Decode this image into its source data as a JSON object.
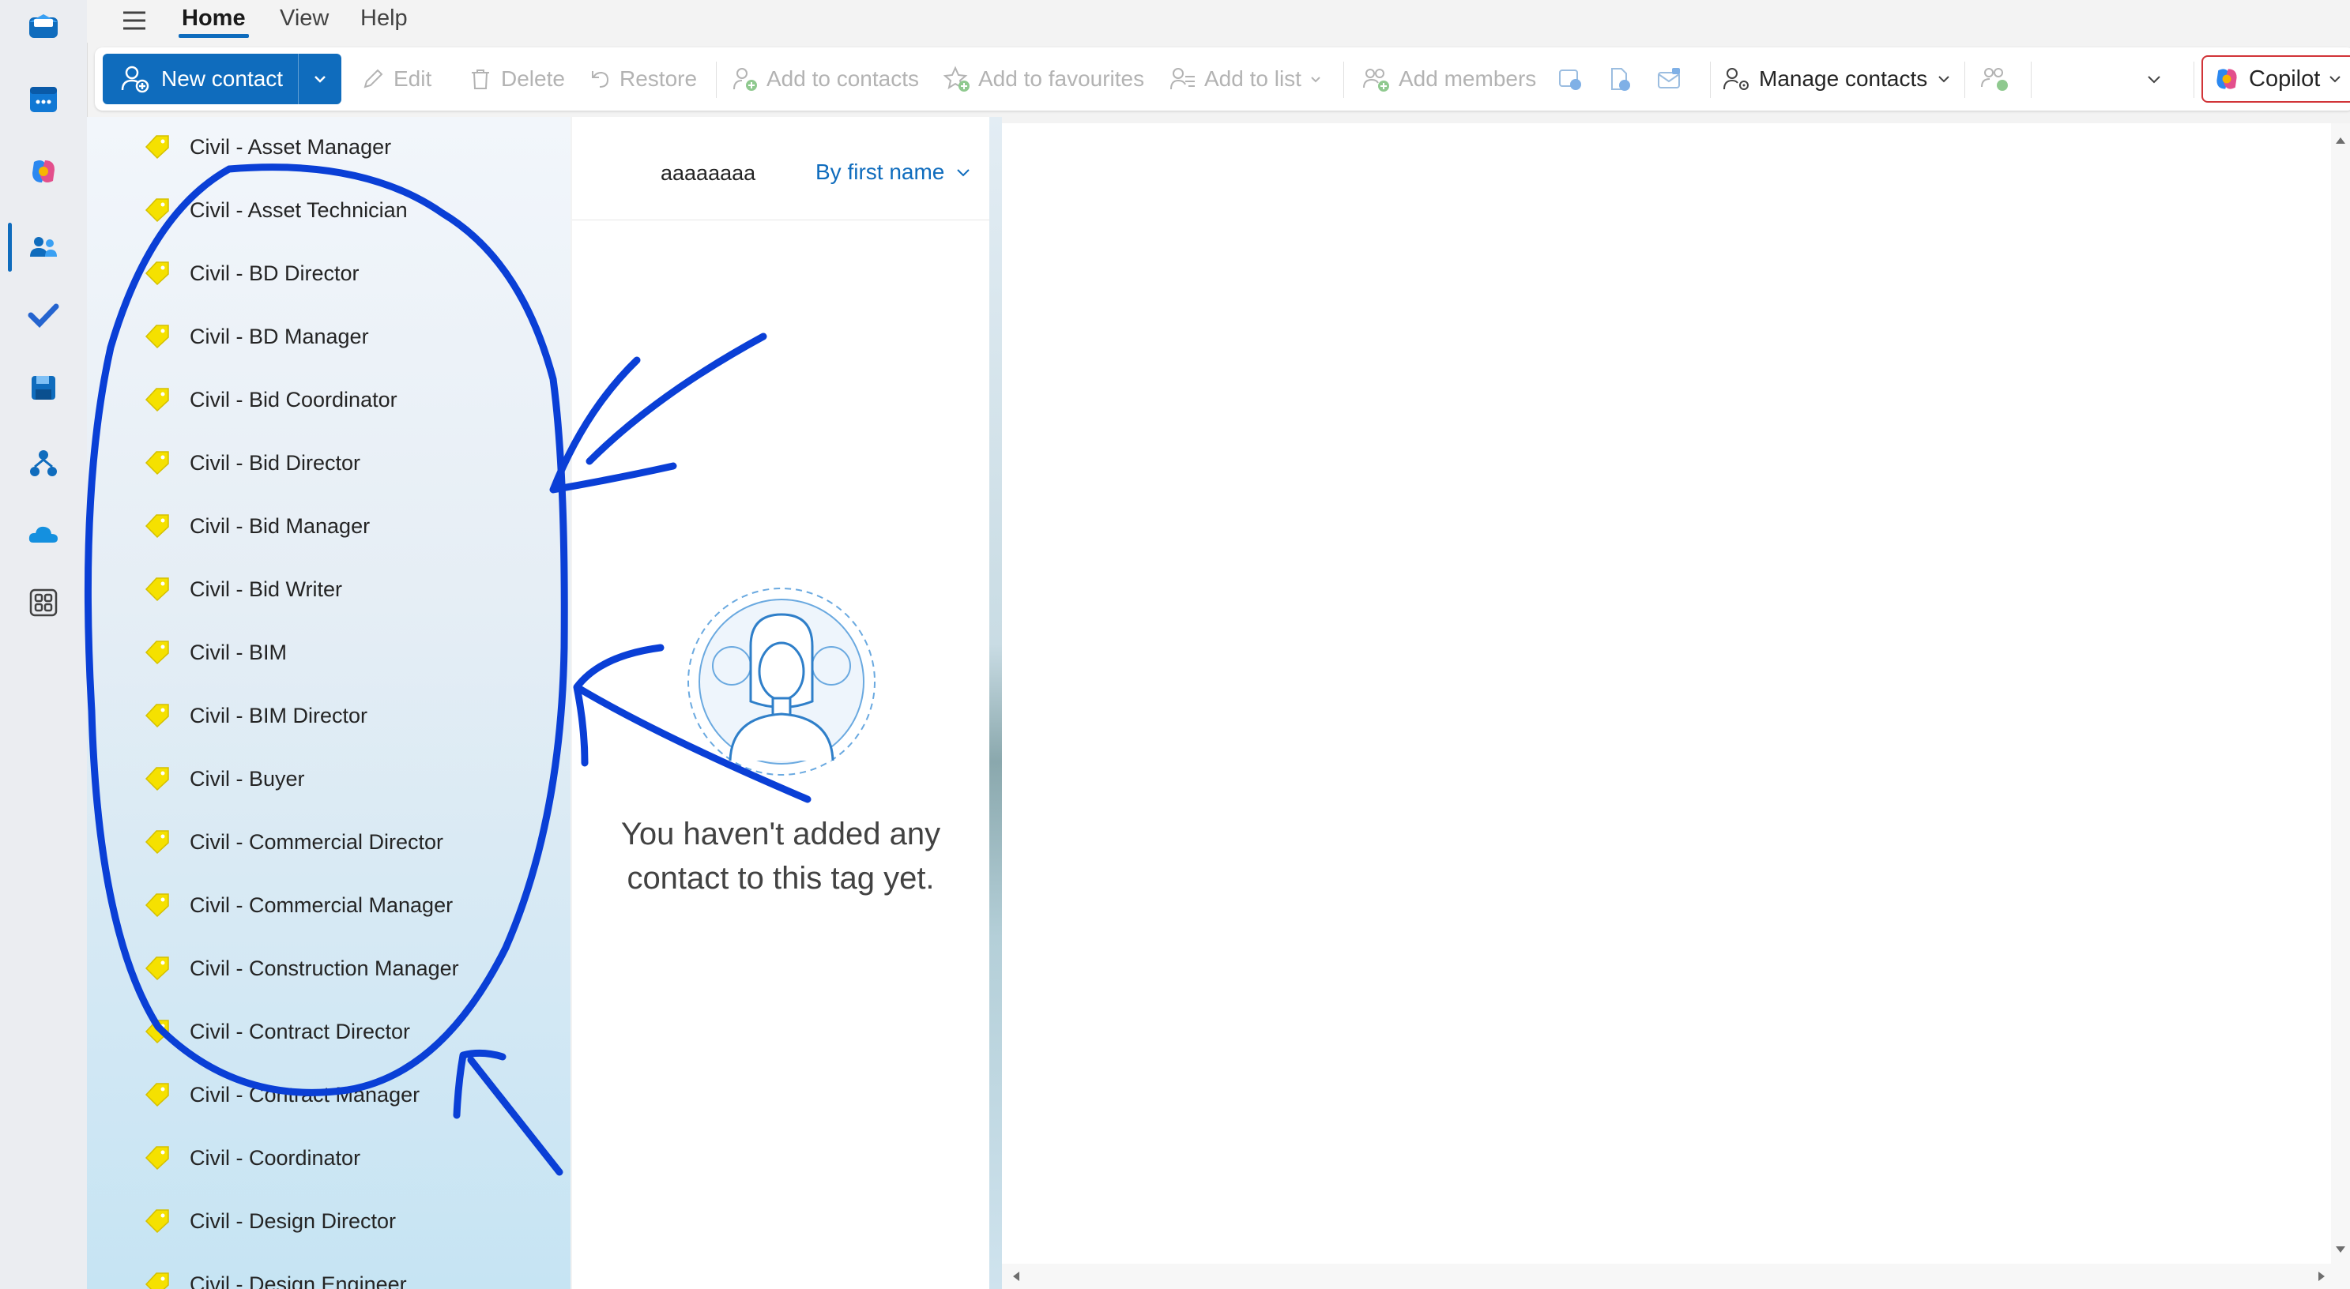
{
  "menu": {
    "tabs": [
      {
        "label": "Home",
        "active": true
      },
      {
        "label": "View",
        "active": false
      },
      {
        "label": "Help",
        "active": false
      }
    ]
  },
  "ribbon": {
    "new_contact": "New contact",
    "edit": "Edit",
    "delete": "Delete",
    "restore": "Restore",
    "add_to_contacts": "Add to contacts",
    "add_to_favourites": "Add to favourites",
    "add_to_list": "Add to list",
    "add_members": "Add members",
    "manage_contacts": "Manage contacts",
    "copilot": "Copilot"
  },
  "sidebar": {
    "tags": [
      "Civil - Asset Manager",
      "Civil - Asset Technician",
      "Civil - BD Director",
      "Civil - BD Manager",
      "Civil - Bid Coordinator",
      "Civil - Bid Director",
      "Civil - Bid Manager",
      "Civil - Bid Writer",
      "Civil - BIM",
      "Civil - BIM Director",
      "Civil - Buyer",
      "Civil - Commercial Director",
      "Civil - Commercial Manager",
      "Civil - Construction Manager",
      "Civil - Contract Director",
      "Civil - Contract Manager",
      "Civil - Coordinator",
      "Civil - Design Director",
      "Civil - Design Engineer"
    ]
  },
  "list": {
    "name": "aaaaaaaa",
    "sort_label": "By first name",
    "empty_line1": "You haven't added any",
    "empty_line2": "contact to this tag yet."
  },
  "colors": {
    "accent": "#0f6cbd",
    "tag": "#f5e100",
    "annotation": "#0a3fd6"
  }
}
